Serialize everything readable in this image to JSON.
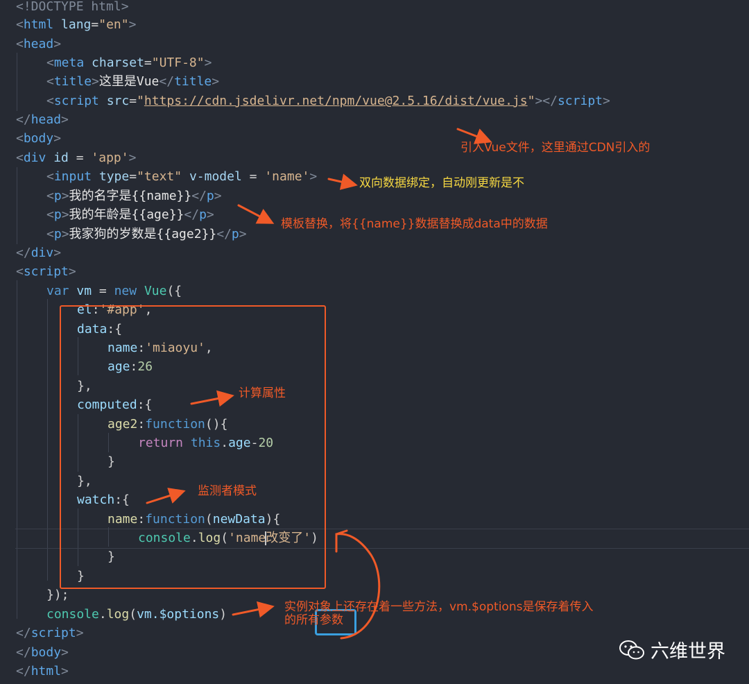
{
  "code": {
    "l1": "<!DOCTYPE html>",
    "l2_tag": "html",
    "l2_attr": "lang",
    "l2_val": "\"en\"",
    "l3_tag": "head",
    "l4_tag": "meta",
    "l4_attr": "charset",
    "l4_val": "\"UTF-8\"",
    "l5_tag": "title",
    "l5_text": "这里是Vue",
    "l6_tag": "script",
    "l6_attr": "src",
    "l6_url": "https://cdn.jsdelivr.net/npm/vue@2.5.16/dist/vue.js",
    "l7_tag": "head",
    "l8_tag": "body",
    "l9_tag": "div",
    "l9_attr": "id",
    "l9_val": "'app'",
    "l10_tag": "input",
    "l10_attr1": "type",
    "l10_val1": "\"text\"",
    "l10_attr2": "v-model",
    "l10_val2": "'name'",
    "l11_text": "我的名字是{{name}}",
    "l12_text": "我的年龄是{{age}}",
    "l13_text": "我家狗的岁数是{{age2}}",
    "l14_tag": "div",
    "l15_tag": "script",
    "l16_var": "var",
    "l16_name": "vm",
    "l16_new": "new",
    "l16_cls": "Vue",
    "l17_key": "el",
    "l17_val": "'#app'",
    "l18_key": "data",
    "l19_key": "name",
    "l19_val": "'miaoyu'",
    "l20_key": "age",
    "l20_val": "26",
    "l22_key": "computed",
    "l23_key": "age2",
    "l23_fn": "function",
    "l24_ret": "return",
    "l24_this": "this",
    "l24_prop": "age",
    "l24_num": "20",
    "l27_key": "watch",
    "l28_key": "name",
    "l28_fn": "function",
    "l28_param": "newData",
    "l29_obj": "console",
    "l29_fn": "log",
    "l29_str1": "'name",
    "l29_str2": "改变了'",
    "l33_obj": "console",
    "l33_fn": "log",
    "l33_arg": "vm.$options",
    "l34_tag": "script",
    "l35_tag": "body",
    "l36_tag": "html"
  },
  "annotations": {
    "cdn": "引入Vue文件，这里通过CDN引入的",
    "binding": "双向数据绑定，自动刚更新是不",
    "template": "模板替换，将{{name}}数据替换成data中的数据",
    "computed": "计算属性",
    "watch": "监测者模式",
    "options_line1": "实例对象上还存在着一些方法，vm.$options是保存着传入",
    "options_line2": "的所有参数"
  },
  "watermark": {
    "label": "六维世界",
    "icon": "wechat-icon"
  },
  "colors": {
    "annotation": "#f05a28",
    "highlight_box": "#f05a28",
    "blue_box": "#3aa0e0",
    "background": "#262a33"
  }
}
